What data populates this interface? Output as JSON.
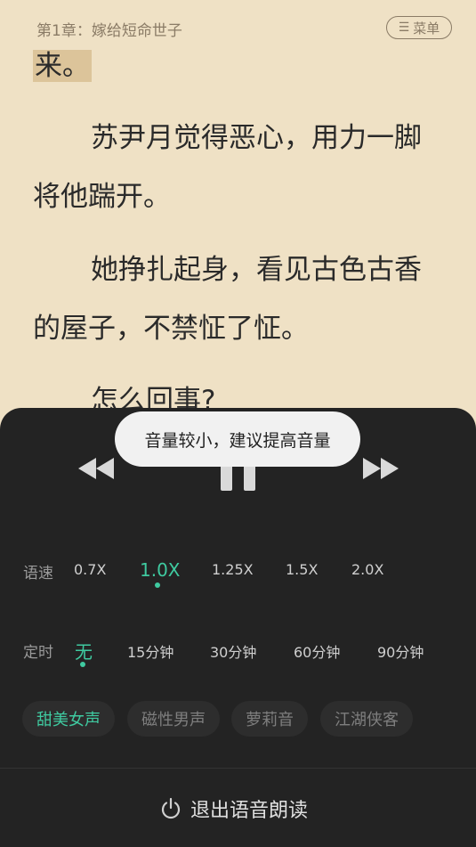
{
  "header": {
    "chapter_title": "第1章：嫁给短命世子",
    "menu_label": "菜单"
  },
  "content": {
    "lines": [
      "来。",
      "苏尹月觉得恶心，用力一脚",
      "将他踹开。",
      "她挣扎起身，看见古色古香",
      "的屋子，不禁怔了怔。",
      "怎么回事?"
    ]
  },
  "toast": "音量较小，建议提高音量",
  "speed": {
    "label": "语速",
    "options": [
      "0.7X",
      "1.0X",
      "1.25X",
      "1.5X",
      "2.0X"
    ],
    "selected": "1.0X"
  },
  "timer": {
    "label": "定时",
    "options": [
      "无",
      "15分钟",
      "30分钟",
      "60分钟",
      "90分钟"
    ],
    "selected": "无"
  },
  "voices": {
    "options": [
      "甜美女声",
      "磁性男声",
      "萝莉音",
      "江湖侠客"
    ],
    "selected": "甜美女声"
  },
  "exit_label": "退出语音朗读",
  "colors": {
    "accent": "#3fcaa0",
    "page_bg": "#efe1c5",
    "panel_bg": "#232323"
  }
}
